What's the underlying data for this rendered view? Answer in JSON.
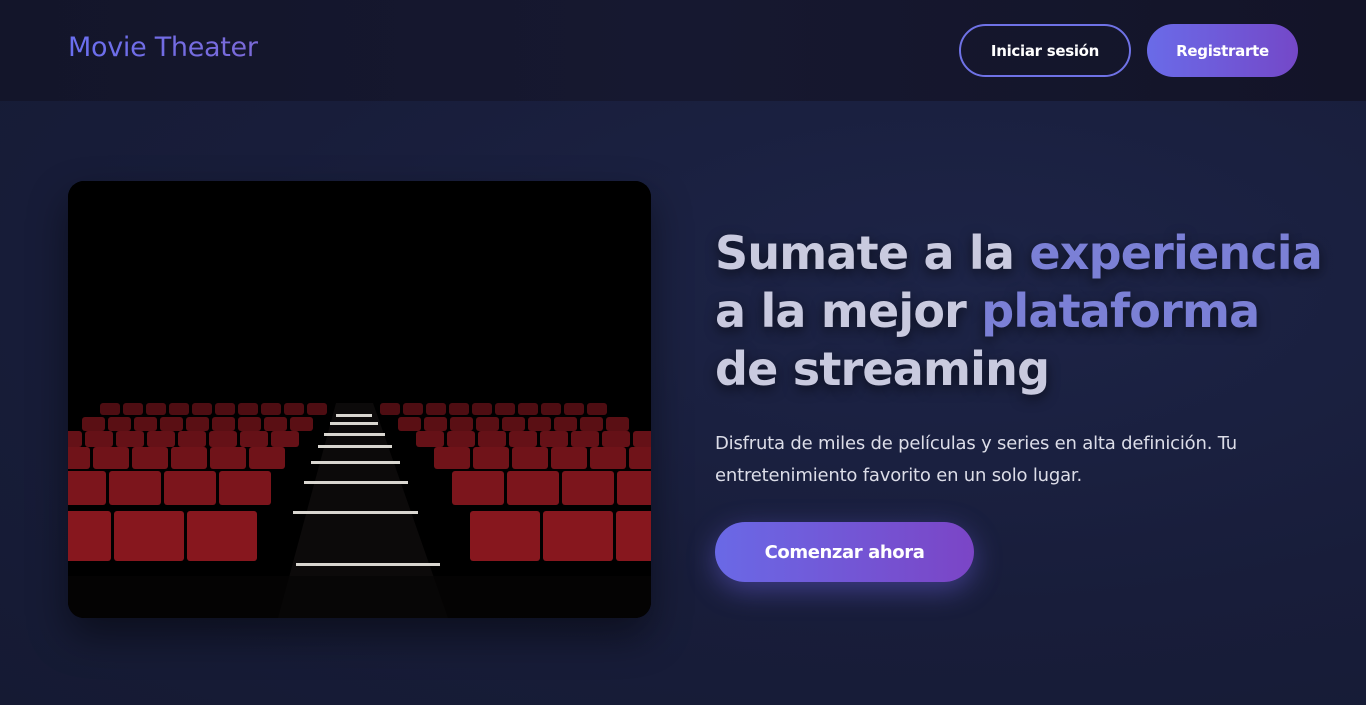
{
  "navbar": {
    "brand": "Movie Theater",
    "login_label": "Iniciar sesión",
    "register_label": "Registrarte"
  },
  "hero": {
    "image_alt": "Sala de cine con butacas rojas",
    "headline": {
      "line1_plain": "Sumate a la ",
      "line1_accent": "experiencia",
      "line2_plain": "a la mejor ",
      "line2_accent": "plataforma",
      "line3_plain": "de streaming"
    },
    "description": "Disfruta de miles de películas y series en alta definición. Tu entretenimiento favorito en un solo lugar.",
    "cta_label": "Comenzar ahora"
  },
  "colors": {
    "accent": "#6a6be8",
    "accent_secondary": "#7448c8",
    "background": "#181d3a",
    "seat_red": "#8e1820"
  }
}
